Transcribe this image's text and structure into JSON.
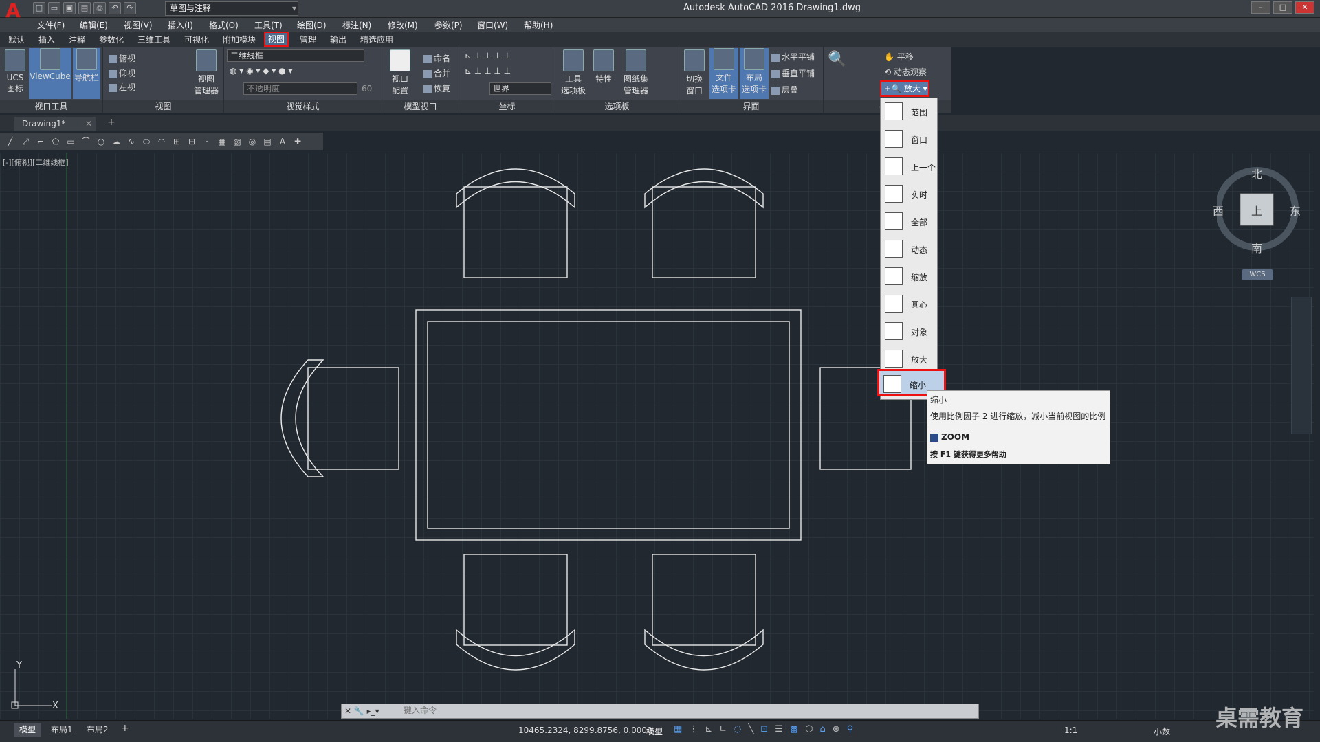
{
  "app": {
    "title": "Autodesk AutoCAD 2016    Drawing1.dwg",
    "workspace": "草图与注释",
    "logo_letter": "A"
  },
  "menu": [
    "文件(F)",
    "编辑(E)",
    "视图(V)",
    "插入(I)",
    "格式(O)",
    "工具(T)",
    "绘图(D)",
    "标注(N)",
    "修改(M)",
    "参数(P)",
    "窗口(W)",
    "帮助(H)"
  ],
  "ribbon_tabs": [
    "默认",
    "插入",
    "注释",
    "参数化",
    "三维工具",
    "可视化",
    "附加模块",
    "视图",
    "管理",
    "输出",
    "精选应用"
  ],
  "active_tab": "视图",
  "ribbon": {
    "viewport_tools": {
      "label": "视口工具",
      "ucs": "UCS\n图标",
      "viewcube": "ViewCube",
      "navbar": "导航栏"
    },
    "views": {
      "label": "视图",
      "items": [
        "俯视",
        "仰视",
        "左视"
      ],
      "manager": "视图\n管理器"
    },
    "visual_styles": {
      "label": "视觉样式",
      "current": "二维线框",
      "opacity_placeholder": "不透明度",
      "opacity_value": "60"
    },
    "model_viewports": {
      "label": "模型视口",
      "config": "视口\n配置",
      "named": "命名",
      "join": "合并",
      "restore": "恢复"
    },
    "coordinates": {
      "label": "坐标",
      "world": "世界"
    },
    "palettes": {
      "label": "选项板",
      "tool_palettes": "工具\n选项板",
      "properties": "特性",
      "sheet_set": "图纸集\n管理器"
    },
    "interface": {
      "label": "界面",
      "switch_window": "切换\n窗口",
      "file_tabs": "文件\n选项卡",
      "layout_tabs": "布局\n选项卡",
      "tile_horizontal": "水平平铺",
      "tile_vertical": "垂直平铺",
      "cascade": "层叠"
    },
    "navigate": {
      "label": "导航",
      "pan": "平移",
      "orbit": "动态观察",
      "zoom": "放大"
    }
  },
  "doc_tab": "Drawing1*",
  "viewport_label": "[-][俯视][二维线框]",
  "zoom_menu": [
    "范围",
    "窗口",
    "上一个",
    "实时",
    "全部",
    "动态",
    "缩放",
    "圆心",
    "对象",
    "放大",
    "缩小"
  ],
  "zoom_selected": "缩小",
  "tooltip": {
    "title": "缩小",
    "desc": "使用比例因子 2 进行缩放，减小当前视图的比例",
    "command": "ZOOM",
    "help": "按 F1 键获得更多帮助"
  },
  "compass": {
    "n": "北",
    "s": "南",
    "e": "东",
    "w": "西",
    "top": "上",
    "wcs": "WCS"
  },
  "command_placeholder": "键入命令",
  "layout_tabs": [
    "模型",
    "布局1",
    "布局2"
  ],
  "coords": "10465.2324, 8299.8756, 0.0000",
  "status": {
    "model": "模型",
    "scale": "1:1",
    "units": "小数"
  },
  "watermark": "桌需教育",
  "ucs": {
    "x": "X",
    "y": "Y"
  },
  "colors": {
    "accent": "#4f78b0",
    "highlight_red": "#e11111",
    "canvas": "#212830"
  }
}
